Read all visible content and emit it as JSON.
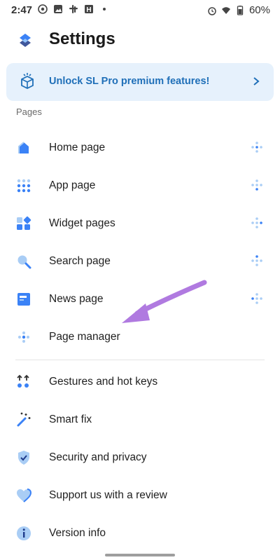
{
  "status_bar": {
    "time": "2:47",
    "battery": "60%",
    "left_icons": [
      "whatsapp-icon",
      "gallery-icon",
      "slack-icon",
      "hnews-icon",
      "dot-icon"
    ],
    "right_icons": [
      "alarm-icon",
      "wifi-icon",
      "battery-icon"
    ]
  },
  "header": {
    "title": "Settings"
  },
  "pro_banner": {
    "text": "Unlock SL Pro premium features!"
  },
  "sections": {
    "pages_label": "Pages"
  },
  "items": [
    {
      "label": "Home page",
      "icon": "home-icon",
      "draggable": true
    },
    {
      "label": "App page",
      "icon": "app-grid-icon",
      "draggable": true
    },
    {
      "label": "Widget pages",
      "icon": "widgets-icon",
      "draggable": true
    },
    {
      "label": "Search page",
      "icon": "search-icon",
      "draggable": true
    },
    {
      "label": "News page",
      "icon": "news-icon",
      "draggable": true
    },
    {
      "label": "Page manager",
      "icon": "page-manager-icon",
      "draggable": false
    },
    {
      "label": "Gestures and hot keys",
      "icon": "gestures-icon",
      "draggable": false
    },
    {
      "label": "Smart fix",
      "icon": "magic-wand-icon",
      "draggable": false
    },
    {
      "label": "Security and privacy",
      "icon": "shield-check-icon",
      "draggable": false
    },
    {
      "label": "Support us with a review",
      "icon": "heart-icon",
      "draggable": false
    },
    {
      "label": "Version info",
      "icon": "info-icon",
      "draggable": false
    }
  ],
  "colors": {
    "accent": "#1f6fb8",
    "banner_bg": "#e6f1fc",
    "icon_blue": "#3b82f6",
    "icon_light": "#a9cdf5",
    "arrow": "#b07ae0"
  }
}
